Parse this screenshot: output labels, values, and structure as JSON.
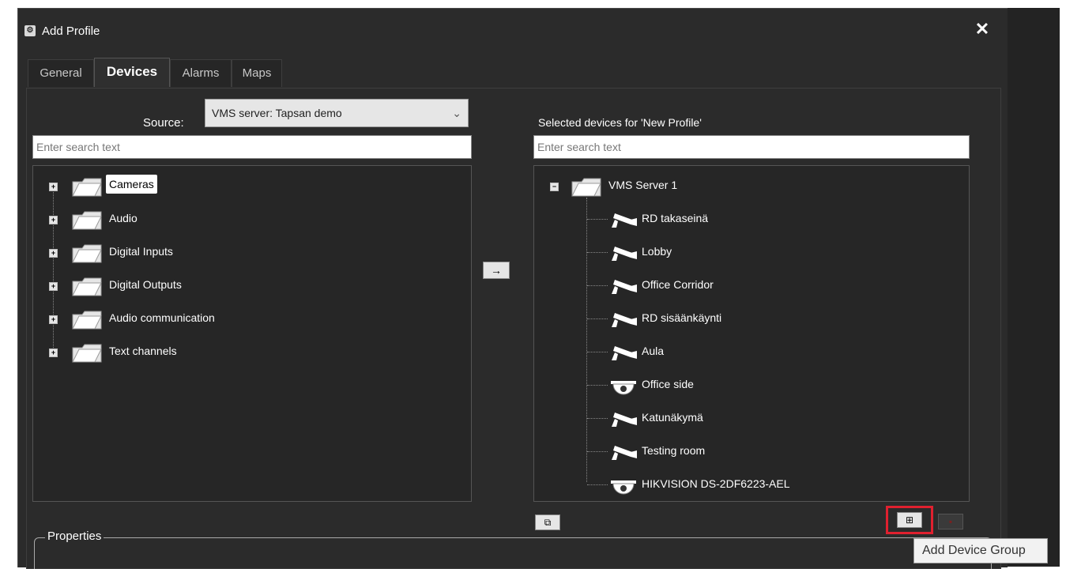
{
  "dialog": {
    "title": "Add Profile",
    "close_icon": "close-icon",
    "tabs": [
      {
        "label": "General",
        "active": false
      },
      {
        "label": "Devices",
        "active": true
      },
      {
        "label": "Alarms",
        "active": false
      },
      {
        "label": "Maps",
        "active": false
      }
    ]
  },
  "source": {
    "label": "Source:",
    "selected": "VMS server: Tapsan demo",
    "search_placeholder": "Enter search text"
  },
  "source_tree": [
    {
      "label": "Cameras",
      "selected": true
    },
    {
      "label": "Audio"
    },
    {
      "label": "Digital Inputs"
    },
    {
      "label": "Digital Outputs"
    },
    {
      "label": "Audio communication"
    },
    {
      "label": "Text channels"
    }
  ],
  "selected": {
    "title": "Selected devices for 'New Profile'",
    "search_placeholder": "Enter search text",
    "root": "VMS Server 1",
    "devices": [
      {
        "label": "RD takaseinä",
        "icon": "bullet-camera-icon"
      },
      {
        "label": "Lobby",
        "icon": "bullet-camera-icon"
      },
      {
        "label": "Office Corridor",
        "icon": "bullet-camera-icon"
      },
      {
        "label": "RD sisäänkäynti",
        "icon": "bullet-camera-icon"
      },
      {
        "label": "Aula",
        "icon": "bullet-camera-icon"
      },
      {
        "label": "Office side",
        "icon": "dome-camera-icon"
      },
      {
        "label": "Katunäkymä",
        "icon": "bullet-camera-icon"
      },
      {
        "label": "Testing room",
        "icon": "bullet-camera-icon"
      },
      {
        "label": "HIKVISION DS-2DF6223-AEL",
        "icon": "dome-camera-icon"
      }
    ]
  },
  "transfer_button": "→",
  "properties": {
    "label": "Properties"
  },
  "tooltip": "Add Device Group",
  "colors": {
    "background": "#2b2b2b",
    "highlight": "#e0202f"
  }
}
